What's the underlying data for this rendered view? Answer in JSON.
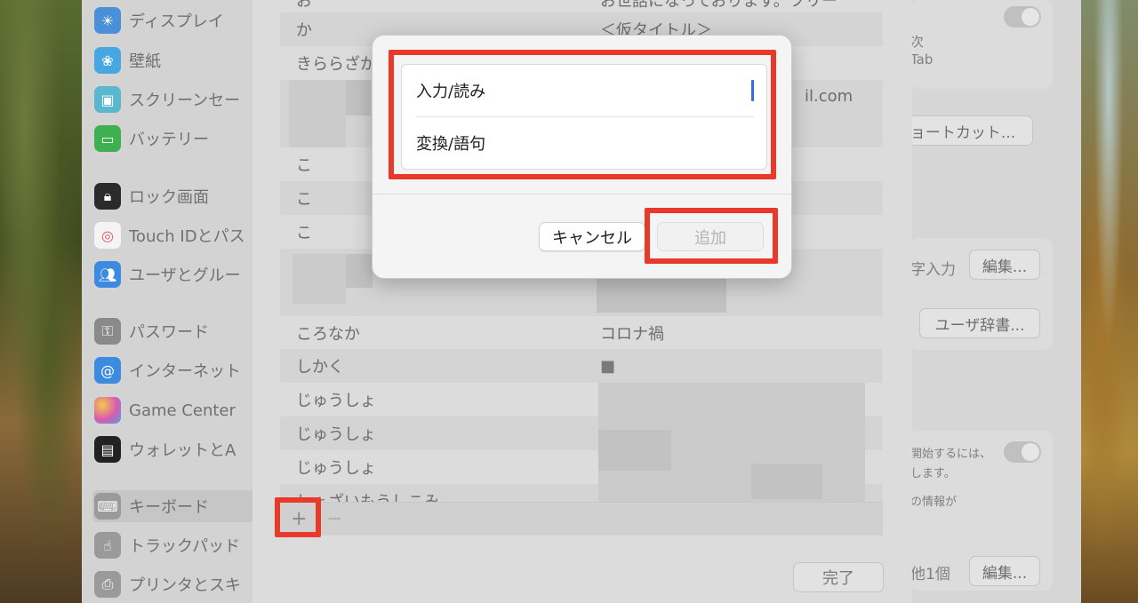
{
  "sidebar": {
    "items": [
      {
        "label": "ディスプレイ",
        "icon": "display-icon",
        "color": "#4a90d9"
      },
      {
        "label": "壁紙",
        "icon": "flower-icon",
        "color": "#48a7e0"
      },
      {
        "label": "スクリーンセー",
        "icon": "screensaver-icon",
        "color": "#59b7d0"
      },
      {
        "label": "バッテリー",
        "icon": "battery-icon",
        "color": "#3fb050"
      },
      {
        "label": "ロック画面",
        "icon": "lock-icon",
        "color": "#2b2b2b"
      },
      {
        "label": "Touch IDとパス",
        "icon": "fingerprint-icon",
        "color": "#ffffff"
      },
      {
        "label": "ユーザとグルー",
        "icon": "users-icon",
        "color": "#3c8be0"
      },
      {
        "label": "パスワード",
        "icon": "key-icon",
        "color": "#8a8a8a"
      },
      {
        "label": "インターネット",
        "icon": "at-icon",
        "color": "#3c8be0"
      },
      {
        "label": "Game Center",
        "icon": "game-center-icon",
        "color": "#d85bb0"
      },
      {
        "label": "ウォレットとA",
        "icon": "wallet-icon",
        "color": "#222222"
      },
      {
        "label": "キーボード",
        "icon": "keyboard-icon",
        "color": "#9a9a9a"
      },
      {
        "label": "トラックパッド",
        "icon": "trackpad-icon",
        "color": "#9a9a9a"
      },
      {
        "label": "プリンタとスキ",
        "icon": "printer-icon",
        "color": "#9a9a9a"
      }
    ]
  },
  "dictionary": {
    "rows": [
      {
        "reading": "お",
        "word": "お世話になっております。フリー"
      },
      {
        "reading": "か",
        "word": "＜仮タイトル＞"
      },
      {
        "reading": "きららざか",
        "word": ""
      },
      {
        "reading": "",
        "word": "il.com"
      },
      {
        "reading": "こ",
        "word": ""
      },
      {
        "reading": "こ",
        "word": ""
      },
      {
        "reading": "こ",
        "word": ""
      },
      {
        "reading": "",
        "word": ""
      },
      {
        "reading": "",
        "word": ""
      },
      {
        "reading": "ころなか",
        "word": "コロナ禍"
      },
      {
        "reading": "しかく",
        "word": "■"
      },
      {
        "reading": "じゅうしょ",
        "word": ""
      },
      {
        "reading": "じゅうしょ",
        "word": ""
      },
      {
        "reading": "じゅうしょ",
        "word": ""
      },
      {
        "reading": "しょざいもうしこみ",
        "word": ""
      }
    ],
    "add_symbol": "+",
    "remove_symbol": "−",
    "done_label": "完了"
  },
  "right_pane": {
    "next_text": "次",
    "tab_text": "Tab",
    "shortcut_button": "ョートカット...",
    "input_text": "字入力",
    "edit_button": "編集...",
    "user_dict_button": "ユーザ辞書...",
    "dictation_text1": "開始するには、",
    "dictation_text2": "します。",
    "dictation_text3": "の情報が",
    "other_text": "他1個",
    "edit_button2": "編集..."
  },
  "dialog": {
    "input_field": "入力/読み",
    "conversion_field": "変換/語句",
    "cancel_label": "キャンセル",
    "add_label": "追加"
  },
  "colors": {
    "highlight": "#e8392a",
    "caret": "#2f6fe0"
  }
}
